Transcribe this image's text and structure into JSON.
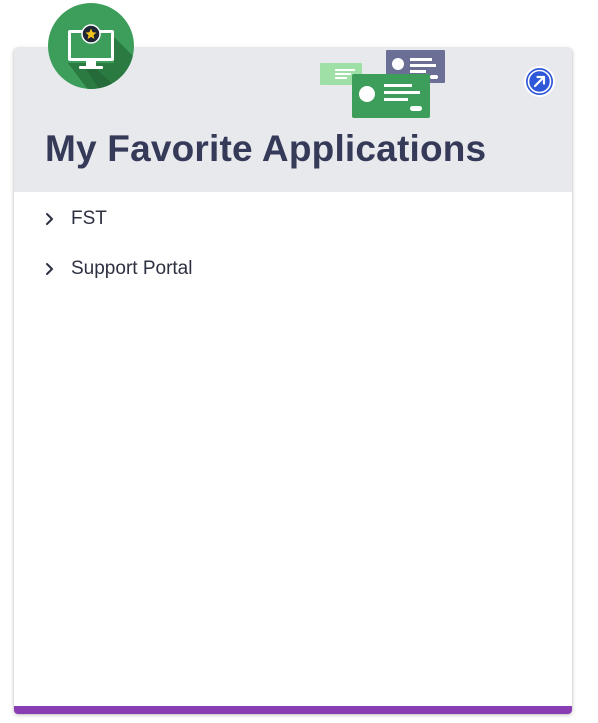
{
  "widget": {
    "title": "My Favorite Applications",
    "icon": "monitor-star-icon",
    "expand_icon": "arrow-up-right-icon"
  },
  "applications": [
    {
      "label": "FST"
    },
    {
      "label": "Support Portal"
    }
  ],
  "colors": {
    "header_bg": "#e8e9ed",
    "title": "#343a57",
    "accent_bar": "#8a3db3",
    "icon_green": "#3c9e5a",
    "expand_button": "#2f57d9"
  }
}
